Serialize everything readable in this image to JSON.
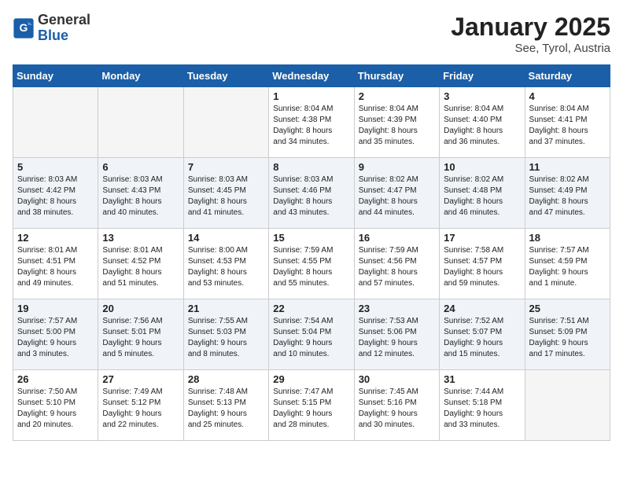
{
  "header": {
    "logo_general": "General",
    "logo_blue": "Blue",
    "title": "January 2025",
    "subtitle": "See, Tyrol, Austria"
  },
  "days_of_week": [
    "Sunday",
    "Monday",
    "Tuesday",
    "Wednesday",
    "Thursday",
    "Friday",
    "Saturday"
  ],
  "weeks": [
    [
      {
        "day": "",
        "info": ""
      },
      {
        "day": "",
        "info": ""
      },
      {
        "day": "",
        "info": ""
      },
      {
        "day": "1",
        "info": "Sunrise: 8:04 AM\nSunset: 4:38 PM\nDaylight: 8 hours\nand 34 minutes."
      },
      {
        "day": "2",
        "info": "Sunrise: 8:04 AM\nSunset: 4:39 PM\nDaylight: 8 hours\nand 35 minutes."
      },
      {
        "day": "3",
        "info": "Sunrise: 8:04 AM\nSunset: 4:40 PM\nDaylight: 8 hours\nand 36 minutes."
      },
      {
        "day": "4",
        "info": "Sunrise: 8:04 AM\nSunset: 4:41 PM\nDaylight: 8 hours\nand 37 minutes."
      }
    ],
    [
      {
        "day": "5",
        "info": "Sunrise: 8:03 AM\nSunset: 4:42 PM\nDaylight: 8 hours\nand 38 minutes."
      },
      {
        "day": "6",
        "info": "Sunrise: 8:03 AM\nSunset: 4:43 PM\nDaylight: 8 hours\nand 40 minutes."
      },
      {
        "day": "7",
        "info": "Sunrise: 8:03 AM\nSunset: 4:45 PM\nDaylight: 8 hours\nand 41 minutes."
      },
      {
        "day": "8",
        "info": "Sunrise: 8:03 AM\nSunset: 4:46 PM\nDaylight: 8 hours\nand 43 minutes."
      },
      {
        "day": "9",
        "info": "Sunrise: 8:02 AM\nSunset: 4:47 PM\nDaylight: 8 hours\nand 44 minutes."
      },
      {
        "day": "10",
        "info": "Sunrise: 8:02 AM\nSunset: 4:48 PM\nDaylight: 8 hours\nand 46 minutes."
      },
      {
        "day": "11",
        "info": "Sunrise: 8:02 AM\nSunset: 4:49 PM\nDaylight: 8 hours\nand 47 minutes."
      }
    ],
    [
      {
        "day": "12",
        "info": "Sunrise: 8:01 AM\nSunset: 4:51 PM\nDaylight: 8 hours\nand 49 minutes."
      },
      {
        "day": "13",
        "info": "Sunrise: 8:01 AM\nSunset: 4:52 PM\nDaylight: 8 hours\nand 51 minutes."
      },
      {
        "day": "14",
        "info": "Sunrise: 8:00 AM\nSunset: 4:53 PM\nDaylight: 8 hours\nand 53 minutes."
      },
      {
        "day": "15",
        "info": "Sunrise: 7:59 AM\nSunset: 4:55 PM\nDaylight: 8 hours\nand 55 minutes."
      },
      {
        "day": "16",
        "info": "Sunrise: 7:59 AM\nSunset: 4:56 PM\nDaylight: 8 hours\nand 57 minutes."
      },
      {
        "day": "17",
        "info": "Sunrise: 7:58 AM\nSunset: 4:57 PM\nDaylight: 8 hours\nand 59 minutes."
      },
      {
        "day": "18",
        "info": "Sunrise: 7:57 AM\nSunset: 4:59 PM\nDaylight: 9 hours\nand 1 minute."
      }
    ],
    [
      {
        "day": "19",
        "info": "Sunrise: 7:57 AM\nSunset: 5:00 PM\nDaylight: 9 hours\nand 3 minutes."
      },
      {
        "day": "20",
        "info": "Sunrise: 7:56 AM\nSunset: 5:01 PM\nDaylight: 9 hours\nand 5 minutes."
      },
      {
        "day": "21",
        "info": "Sunrise: 7:55 AM\nSunset: 5:03 PM\nDaylight: 9 hours\nand 8 minutes."
      },
      {
        "day": "22",
        "info": "Sunrise: 7:54 AM\nSunset: 5:04 PM\nDaylight: 9 hours\nand 10 minutes."
      },
      {
        "day": "23",
        "info": "Sunrise: 7:53 AM\nSunset: 5:06 PM\nDaylight: 9 hours\nand 12 minutes."
      },
      {
        "day": "24",
        "info": "Sunrise: 7:52 AM\nSunset: 5:07 PM\nDaylight: 9 hours\nand 15 minutes."
      },
      {
        "day": "25",
        "info": "Sunrise: 7:51 AM\nSunset: 5:09 PM\nDaylight: 9 hours\nand 17 minutes."
      }
    ],
    [
      {
        "day": "26",
        "info": "Sunrise: 7:50 AM\nSunset: 5:10 PM\nDaylight: 9 hours\nand 20 minutes."
      },
      {
        "day": "27",
        "info": "Sunrise: 7:49 AM\nSunset: 5:12 PM\nDaylight: 9 hours\nand 22 minutes."
      },
      {
        "day": "28",
        "info": "Sunrise: 7:48 AM\nSunset: 5:13 PM\nDaylight: 9 hours\nand 25 minutes."
      },
      {
        "day": "29",
        "info": "Sunrise: 7:47 AM\nSunset: 5:15 PM\nDaylight: 9 hours\nand 28 minutes."
      },
      {
        "day": "30",
        "info": "Sunrise: 7:45 AM\nSunset: 5:16 PM\nDaylight: 9 hours\nand 30 minutes."
      },
      {
        "day": "31",
        "info": "Sunrise: 7:44 AM\nSunset: 5:18 PM\nDaylight: 9 hours\nand 33 minutes."
      },
      {
        "day": "",
        "info": ""
      }
    ]
  ]
}
